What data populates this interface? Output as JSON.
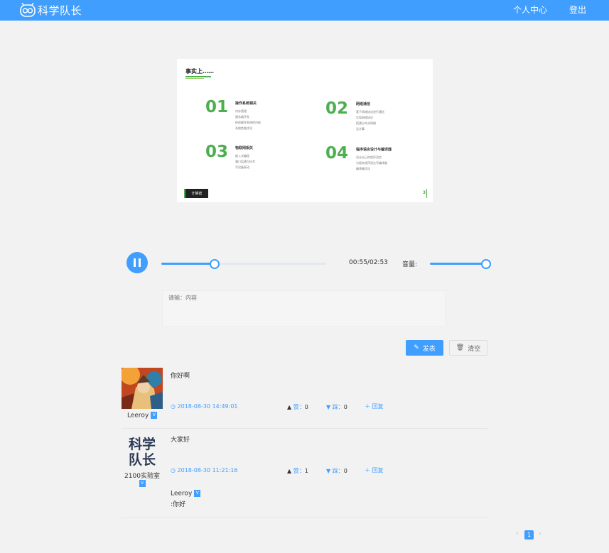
{
  "header": {
    "logo_text": "科学队长",
    "nav": {
      "profile": "个人中心",
      "logout": "登出"
    },
    "bg_color": "#409eff"
  },
  "slide": {
    "title": "事实上……",
    "sections": [
      {
        "num": "01",
        "heading": "操作系统相关",
        "items": [
          "内存管理",
          "服务器开发",
          "修改操作系统的内核",
          "系统性能优化"
        ]
      },
      {
        "num": "02",
        "heading": "网络通信",
        "items": [
          "基于网络协议进行通信",
          "实现网络协议",
          "搭建分布式网络",
          "云计算"
        ]
      },
      {
        "num": "03",
        "heading": "物联网相关",
        "items": [
          "嵌入式编程",
          "端口层通与技术",
          "写设备驱动"
        ]
      },
      {
        "num": "04",
        "heading": "程序语言设计与编译器",
        "items": [
          "设计自己的程序语言",
          "为现有程序语言写编译器",
          "编译器优化"
        ]
      }
    ],
    "badge": "计算密",
    "page": "3"
  },
  "player": {
    "state": "playing",
    "time": "00:55/02:53",
    "progress": 0.318,
    "volume_label": "音量:",
    "volume": 1.0
  },
  "comment_input": {
    "placeholder": "请输：内容",
    "publish_label": "发表",
    "clear_label": "清空"
  },
  "comments": [
    {
      "user": "Leeroy",
      "text": "你好啊",
      "time": "2018-08-30 14:49:01",
      "likes_label": "赞：",
      "likes": "0",
      "dislikes_label": "踩：",
      "dislikes": "0",
      "reply_label": "回复"
    },
    {
      "user": "2100实验室",
      "avatar_text": [
        "科学",
        "队长"
      ],
      "text": "大家好",
      "time": "2018-08-30 11:21:16",
      "likes_label": "赞：",
      "likes": "1",
      "dislikes_label": "踩：",
      "dislikes": "0",
      "reply_label": "回复",
      "reply": {
        "user": "Leeroy",
        "text": ":你好"
      }
    }
  ],
  "pagination": {
    "current": "1",
    "prev": "‹",
    "next": "›"
  },
  "vip_badge": "V"
}
